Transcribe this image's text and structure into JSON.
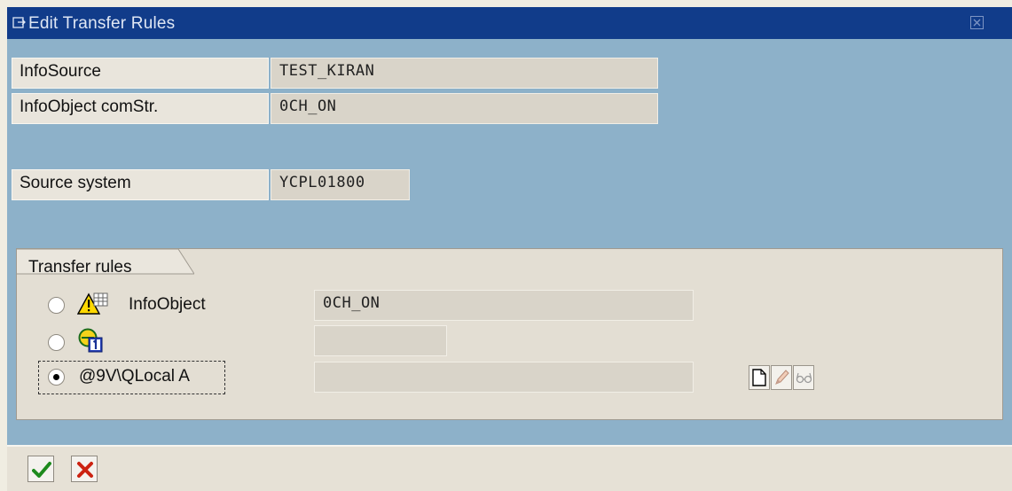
{
  "window": {
    "title": "Edit Transfer Rules"
  },
  "header": {
    "infosource": {
      "label": "InfoSource",
      "value": "TEST_KIRAN"
    },
    "infoobject_comstr": {
      "label": "InfoObject comStr.",
      "value": "0CH_ON"
    },
    "source_system": {
      "label": "Source system",
      "value": "YCPL01800"
    }
  },
  "transfer_rules": {
    "title": "Transfer rules",
    "rows": [
      {
        "label": "InfoObject",
        "value": "0CH_ON",
        "selected": false,
        "icon": "warning-grid-icon"
      },
      {
        "label": "",
        "value": "",
        "selected": false,
        "icon": "constant-icon"
      },
      {
        "label": "@9V\\QLocal A",
        "value": "",
        "selected": true,
        "icon": ""
      }
    ],
    "tools": [
      "create-icon",
      "edit-pencil-icon",
      "display-glasses-icon"
    ]
  },
  "actions": {
    "confirm": {
      "icon": "checkmark-icon",
      "color": "#1d8a1d"
    },
    "cancel": {
      "icon": "cross-icon",
      "color": "#cc2211"
    }
  }
}
